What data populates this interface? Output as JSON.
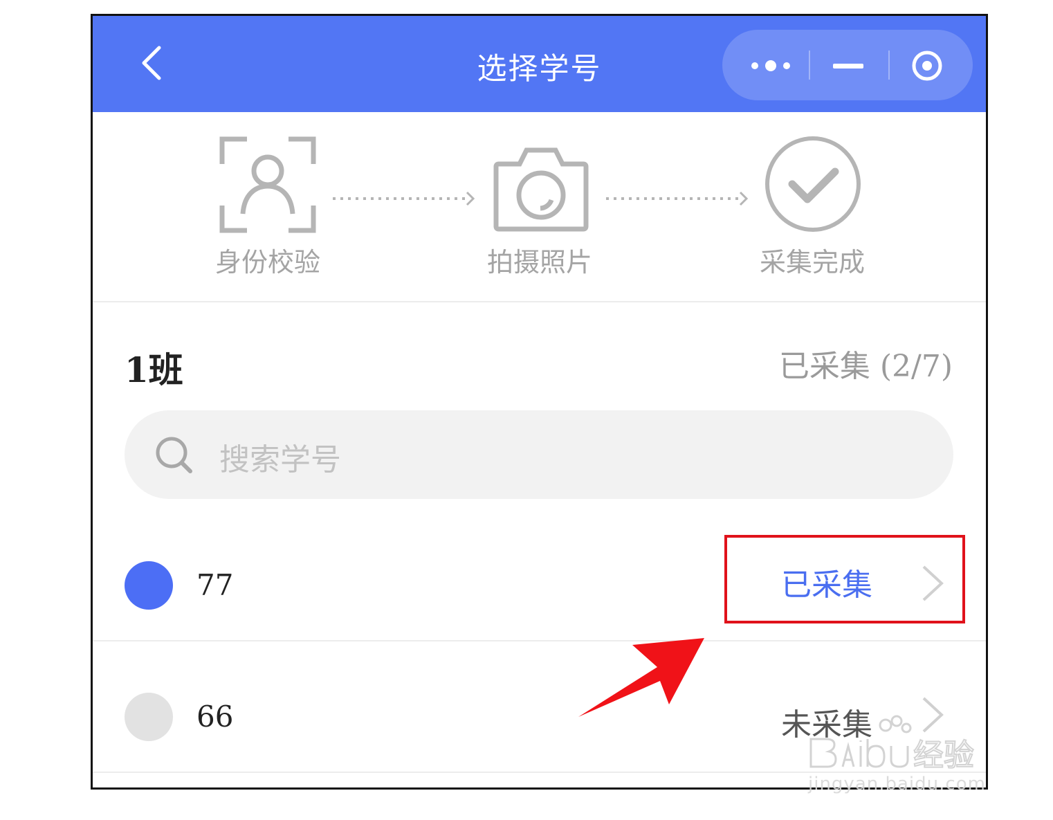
{
  "navbar": {
    "title": "选择学号",
    "back_icon": "chevron-left-icon",
    "capsule_icons": [
      "more-dots-icon",
      "minimize-icon",
      "target-close-icon"
    ],
    "color": "#5276F4"
  },
  "steps": [
    {
      "label": "身份校验",
      "icon": "face-scan-icon"
    },
    {
      "label": "拍摄照片",
      "icon": "camera-icon"
    },
    {
      "label": "采集完成",
      "icon": "check-circle-icon"
    }
  ],
  "class_section": {
    "title": "1班",
    "collected_count": "已采集 (2/7)"
  },
  "search": {
    "placeholder": "搜索学号"
  },
  "students": [
    {
      "id": "77",
      "status": "已采集",
      "status_color": "#4a6ef0",
      "dot_color": "#4c6ef5"
    },
    {
      "id": "66",
      "status": "未采集",
      "status_color": "#555555",
      "dot_color": "#e2e2e2"
    }
  ],
  "annotation": {
    "highlight_color": "#e0121b"
  },
  "watermark": {
    "brand": "Baidu经验",
    "url": "jingyan.baidu.com"
  }
}
